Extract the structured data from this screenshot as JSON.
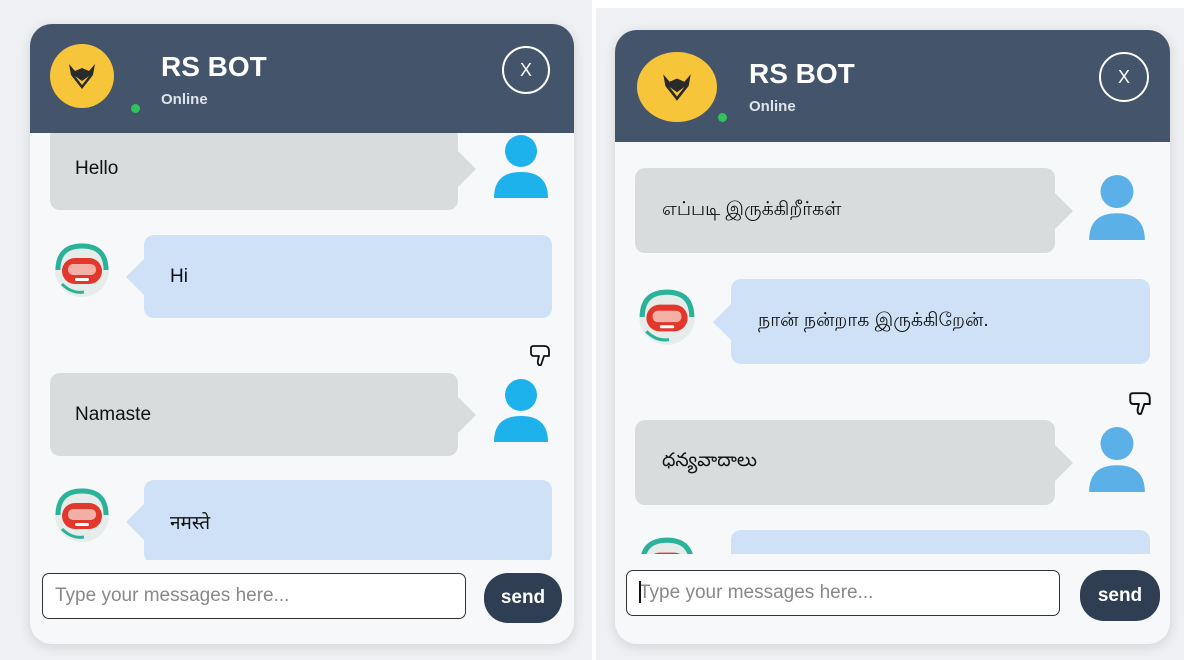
{
  "bot": {
    "name": "RS BOT",
    "status": "Online"
  },
  "close_label": "X",
  "input": {
    "placeholder": "Type your messages here...",
    "value": ""
  },
  "send_label": "send",
  "left_panel": {
    "messages": [
      {
        "from": "user",
        "text": "Hello"
      },
      {
        "from": "bot",
        "text": "Hi"
      },
      {
        "from": "user",
        "text": "Namaste"
      },
      {
        "from": "bot",
        "text": "नमस्ते"
      }
    ]
  },
  "right_panel": {
    "messages": [
      {
        "from": "user",
        "text": "எப்படி இருக்கிறீர்கள்"
      },
      {
        "from": "bot",
        "text": "நான் நன்றாக இருக்கிறேன்."
      },
      {
        "from": "user",
        "text": "ధన్యవాదాలు"
      },
      {
        "from": "bot",
        "text": ""
      }
    ]
  },
  "colors": {
    "header": "#44546b",
    "logo": "#f6c53a",
    "user_bubble": "#d8dcdd",
    "bot_bubble": "#cfe1f7",
    "user_avatar_left": "#1eb2ec",
    "user_avatar_right": "#5bb0e8",
    "send_button": "#2f3e52",
    "online": "#2fc35a"
  },
  "icons": [
    "bot-logo-icon",
    "user-avatar-icon",
    "bot-avatar-icon",
    "thumbs-down-icon",
    "close-icon"
  ]
}
